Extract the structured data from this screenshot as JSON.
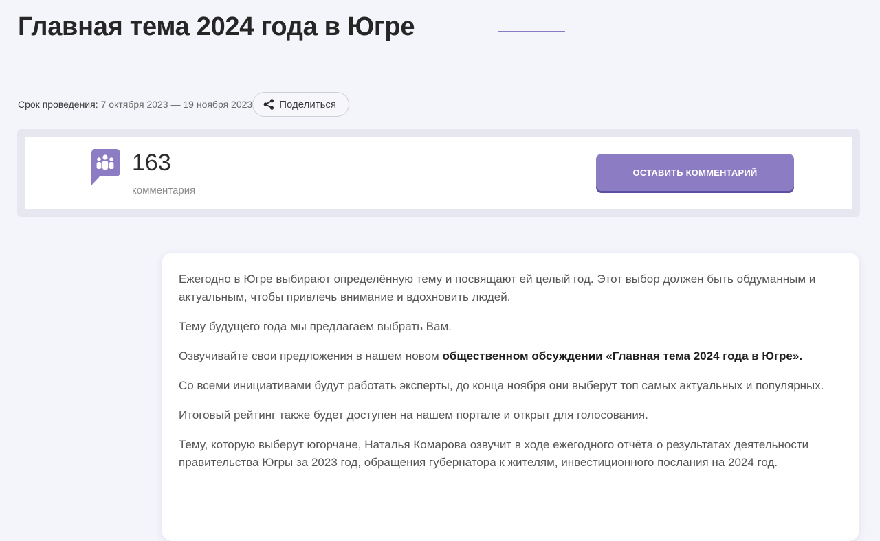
{
  "page": {
    "title": "Главная тема 2024 года в Югре"
  },
  "meta": {
    "deadline_label": "Срок проведения:",
    "deadline_value": "7 октября 2023 — 19 ноября 2023",
    "share_label": "Поделиться"
  },
  "stats": {
    "comments_count": "163",
    "comments_label": "комментария",
    "leave_comment_label": "ОСТАВИТЬ КОММЕНТАРИЙ"
  },
  "content": {
    "p1": "Ежегодно в Югре выбирают определённую тему и посвящают ей целый год. Этот выбор должен быть обдуманным и актуальным, чтобы привлечь внимание и вдохновить людей.",
    "p2": "Тему будущего года мы предлагаем выбрать Вам.",
    "p3_prefix": "Озвучивайте свои предложения в нашем новом ",
    "p3_bold": "общественном обсуждении «Главная тема 2024 года в Югре».",
    "p4": "Со всеми инициативами будут работать эксперты, до конца ноября они выберут топ самых актуальных и популярных.",
    "p5": "Итоговый рейтинг также будет доступен на нашем портале и открыт для голосования.",
    "p6": "Тему, которую выберут югорчане, Наталья Комарова озвучит в ходе ежегодного отчёта о результатах деятельности правительства Югры за 2023 год, обращения губернатора к жителям, инвестиционного послания на 2024 год."
  },
  "icons": {
    "share": "share-icon",
    "comments": "people-chat-icon"
  },
  "colors": {
    "accent": "#8c7cc3",
    "background": "#f4f4fb",
    "panel_border": "#e7e7f2"
  }
}
